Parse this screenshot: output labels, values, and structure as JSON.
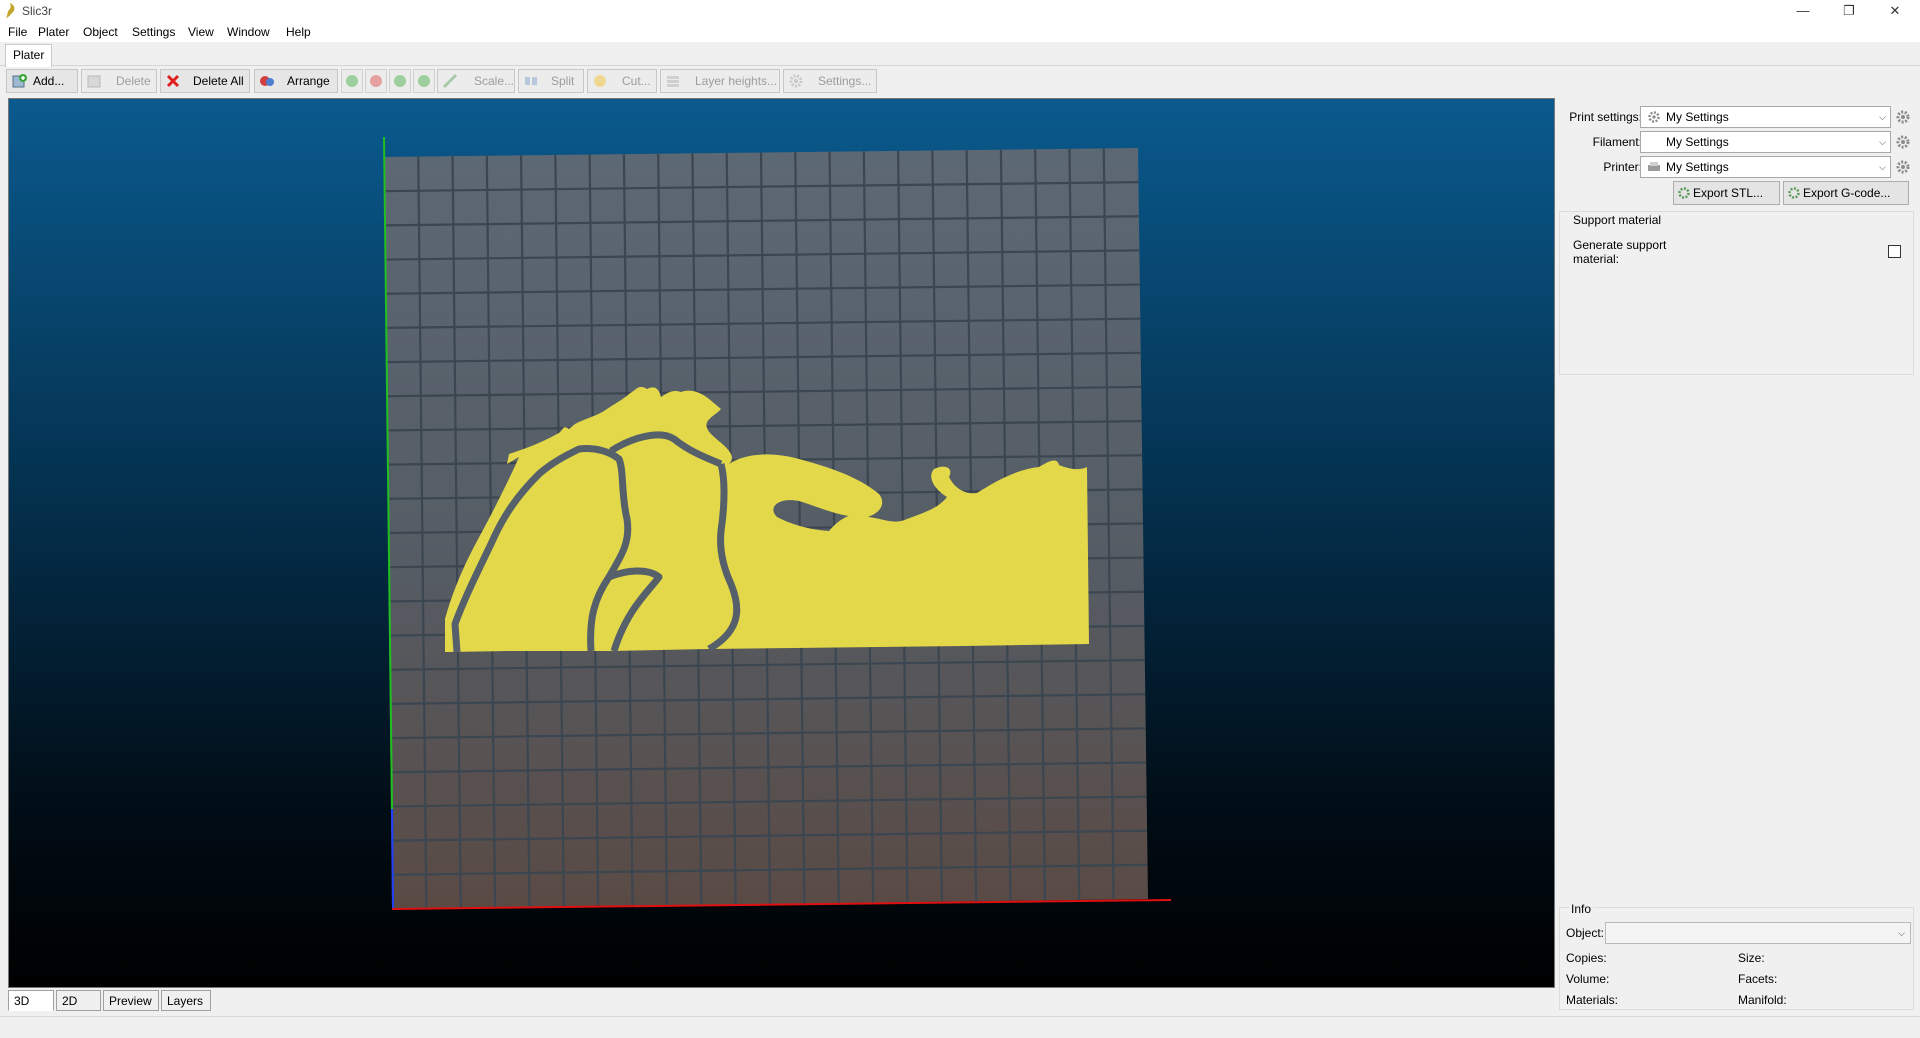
{
  "window": {
    "title": "Slic3r",
    "controls": [
      "—",
      "❐",
      "✕"
    ]
  },
  "menu": [
    "File",
    "Plater",
    "Object",
    "Settings",
    "View",
    "Window",
    "Help"
  ],
  "tabs": {
    "plater": "Plater"
  },
  "toolbar": {
    "add": "Add...",
    "delete": "Delete",
    "delete_all": "Delete All",
    "arrange": "Arrange",
    "scale": "Scale...",
    "split": "Split",
    "cut": "Cut...",
    "layer_heights": "Layer heights...",
    "settings": "Settings..."
  },
  "view_tabs": [
    "3D",
    "2D",
    "Preview",
    "Layers"
  ],
  "right_panel": {
    "print_settings": {
      "label": "Print settings:",
      "value": "My Settings"
    },
    "filament": {
      "label": "Filament:",
      "value": "My Settings"
    },
    "printer": {
      "label": "Printer:",
      "value": "My Settings"
    },
    "export_stl": "Export STL...",
    "export_gcode": "Export G-code...",
    "support": {
      "title": "Support material",
      "generate_label": "Generate support material:",
      "generate_checked": false
    },
    "info": {
      "title": "Info",
      "object_label": "Object:",
      "object_value": "",
      "copies": "Copies:",
      "size": "Size:",
      "volume": "Volume:",
      "facets": "Facets:",
      "materials": "Materials:",
      "manifold": "Manifold:"
    }
  },
  "colors": {
    "bed": "#55606a",
    "object": "#e3d84a",
    "x_axis": "#e01010",
    "y_axis": "#20c020",
    "z_axis": "#2040ff"
  },
  "icons": [
    "slic3r-logo-icon",
    "add-icon",
    "delete-icon",
    "delete-all-icon",
    "arrange-icon",
    "increase-icon",
    "decrease-icon",
    "rotate-ccw-icon",
    "rotate-cw-icon",
    "scale-icon",
    "split-icon",
    "cut-icon",
    "layer-heights-icon",
    "settings-icon",
    "gear-icon",
    "chevron-down-icon",
    "printer-icon"
  ]
}
